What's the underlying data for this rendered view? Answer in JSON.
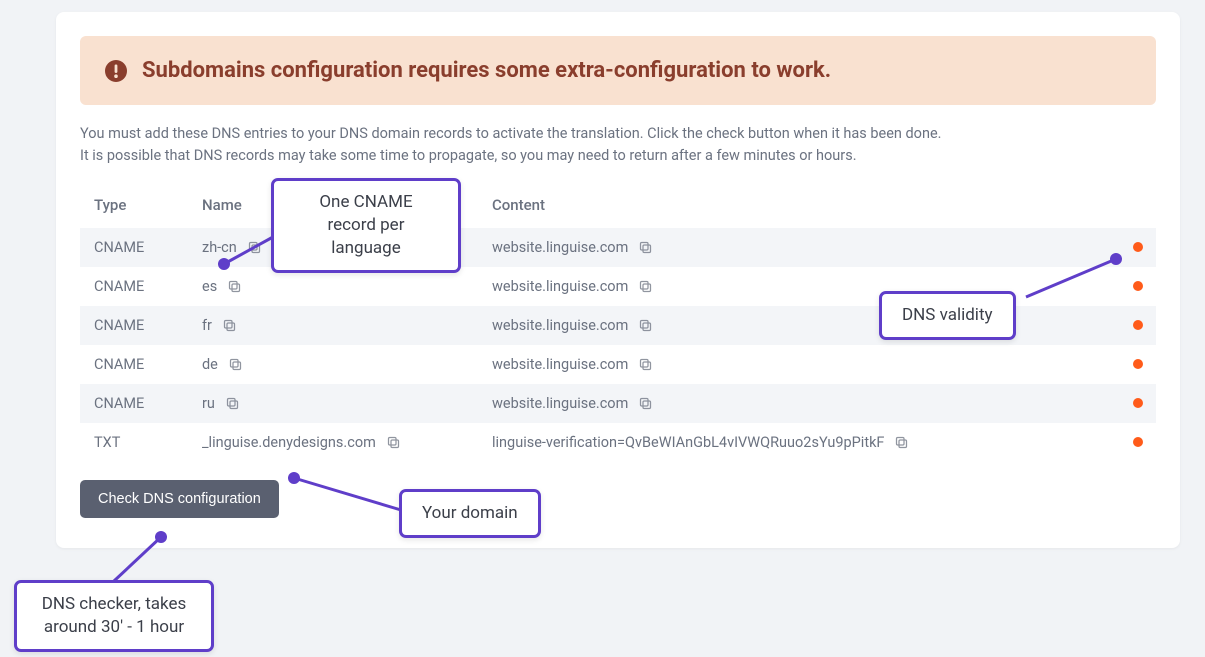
{
  "alert": {
    "title": "Subdomains configuration requires some extra-configuration to work."
  },
  "description": {
    "line1": "You must add these DNS entries to your DNS domain records to activate the translation. Click the check button when it has been done.",
    "line2": "It is possible that DNS records may take some time to propagate, so you may need to return after a few minutes or hours."
  },
  "table": {
    "headers": {
      "type": "Type",
      "name": "Name",
      "content": "Content"
    },
    "rows": [
      {
        "type": "CNAME",
        "name": "zh-cn",
        "content": "website.linguise.com"
      },
      {
        "type": "CNAME",
        "name": "es",
        "content": "website.linguise.com"
      },
      {
        "type": "CNAME",
        "name": "fr",
        "content": "website.linguise.com"
      },
      {
        "type": "CNAME",
        "name": "de",
        "content": "website.linguise.com"
      },
      {
        "type": "CNAME",
        "name": "ru",
        "content": "website.linguise.com"
      },
      {
        "type": "TXT",
        "name": "_linguise.denydesigns.com",
        "content": "linguise-verification=QvBeWIAnGbL4vIVWQRuuo2sYu9pPitkF"
      }
    ]
  },
  "button": {
    "check_label": "Check DNS configuration"
  },
  "callouts": {
    "cname_per_lang": "One CNAME\nrecord per\nlanguage",
    "dns_validity": "DNS validity",
    "your_domain": "Your domain",
    "dns_checker": "DNS checker, takes\naround 30' - 1 hour"
  },
  "colors": {
    "accent_purple": "#5f3ec9",
    "status_orange": "#ff5b1a"
  }
}
